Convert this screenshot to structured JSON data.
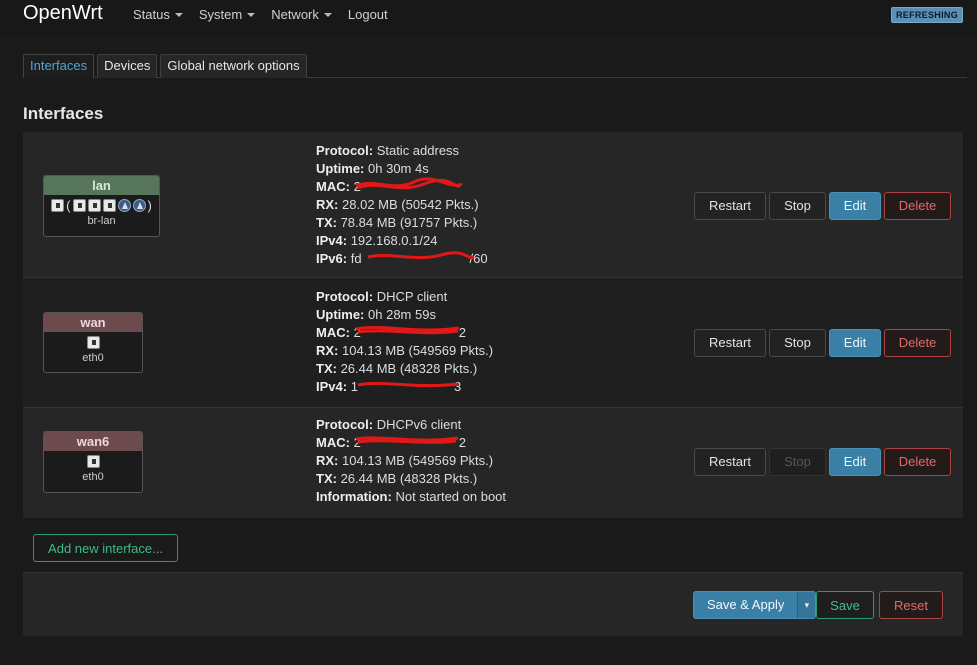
{
  "brand": "OpenWrt",
  "nav": [
    "Status",
    "System",
    "Network",
    "Logout"
  ],
  "refresh_badge": "REFRESHING",
  "tabs": [
    "Interfaces",
    "Devices",
    "Global network options"
  ],
  "page_title": "Interfaces",
  "labels": {
    "protocol": "Protocol:",
    "uptime": "Uptime:",
    "mac": "MAC:",
    "rx": "RX:",
    "tx": "TX:",
    "ipv4": "IPv4:",
    "ipv6": "IPv6:",
    "information": "Information:"
  },
  "buttons": {
    "restart": "Restart",
    "stop": "Stop",
    "edit": "Edit",
    "delete": "Delete"
  },
  "interfaces": [
    {
      "name": "lan",
      "device": "br-lan",
      "protocol": "Static address",
      "uptime": "0h 30m 4s",
      "mac": "2",
      "rx": "28.02 MB (50542 Pkts.)",
      "tx": "78.84 MB (91757 Pkts.)",
      "ipv4": "192.168.0.1/24",
      "ipv6": "fd",
      "ipv6_tail": "/60",
      "stop_enabled": true
    },
    {
      "name": "wan",
      "device": "eth0",
      "protocol": "DHCP client",
      "uptime": "0h 28m 59s",
      "mac": "2",
      "mac_tail": "2",
      "rx": "104.13 MB (549569 Pkts.)",
      "tx": "26.44 MB (48328 Pkts.)",
      "ipv4": "1",
      "ipv4_tail": "3",
      "stop_enabled": true
    },
    {
      "name": "wan6",
      "device": "eth0",
      "protocol": "DHCPv6 client",
      "mac": "2",
      "mac_tail": "2",
      "rx": "104.13 MB (549569 Pkts.)",
      "tx": "26.44 MB (48328 Pkts.)",
      "information": "Not started on boot",
      "stop_enabled": false
    }
  ],
  "add_interface": "Add new interface...",
  "footer": {
    "save_apply": "Save & Apply",
    "dropdown_glyph": "▾",
    "save": "Save",
    "reset": "Reset"
  },
  "colors": {
    "accent": "#3a7fa5",
    "success": "#42b886",
    "danger": "#e36a66",
    "lan_header": "#56755a",
    "wan_header": "#6c4a4e"
  }
}
